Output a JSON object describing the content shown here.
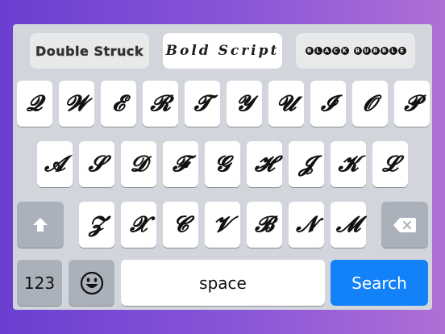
{
  "style_tabs": {
    "double_struck": "Double Struck",
    "bold_script": "Bold Script",
    "black_bubble": "BLACK BUBBLE"
  },
  "keys": {
    "row1": [
      "𝓠",
      "𝓦",
      "𝓔",
      "𝓡",
      "𝓣",
      "𝓨",
      "𝓤",
      "𝓘",
      "𝓞",
      "𝓟"
    ],
    "row2": [
      "𝓐",
      "𝓢",
      "𝓓",
      "𝓕",
      "𝓖",
      "𝓗",
      "𝓙",
      "𝓚",
      "𝓛"
    ],
    "row3": [
      "𝓩",
      "𝓧",
      "𝓒",
      "𝓥",
      "𝓑",
      "𝓝",
      "𝓜"
    ]
  },
  "bottom_row": {
    "numbers_label": "123",
    "emoji_icon": "emoji-icon",
    "space_label": "space",
    "search_label": "Search"
  },
  "icons": {
    "shift": "shift-icon",
    "backspace": "backspace-icon"
  },
  "colors": {
    "keyboard_bg": "#d2d6dc",
    "key_bg": "#ffffff",
    "function_key_bg": "#abb1ba",
    "search_bg": "#1381f7"
  }
}
